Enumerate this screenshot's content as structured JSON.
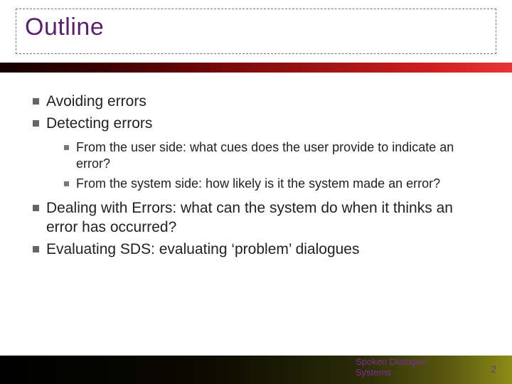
{
  "title": "Outline",
  "bullets": [
    {
      "text": "Avoiding errors",
      "sub": []
    },
    {
      "text": "Detecting errors",
      "sub": [
        "From the user side:  what cues does the user provide to indicate an error?",
        "From the system side:  how likely is it the system made an error?"
      ]
    },
    {
      "text": "Dealing with Errors:  what can the system do when it thinks an error has occurred?",
      "sub": []
    },
    {
      "text": "Evaluating SDS:  evaluating ‘problem’ dialogues",
      "sub": []
    }
  ],
  "footer": {
    "line1": "Spoken Dialogue",
    "line2": "Systems"
  },
  "page_number": "2"
}
